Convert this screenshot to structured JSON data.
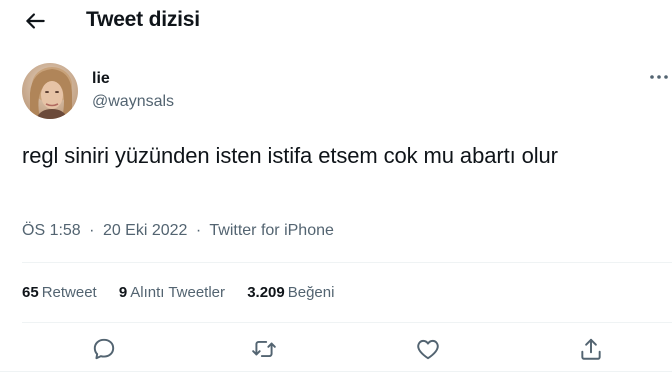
{
  "header": {
    "title": "Tweet dizisi",
    "back_icon": "arrow-left-icon"
  },
  "author": {
    "display_name": "lie",
    "handle": "@waynsals",
    "avatar_icon": "profile-photo"
  },
  "tweet": {
    "text": "regl siniri yüzünden isten istifa etsem cok mu abartı olur",
    "time": "ÖS 1:58",
    "date": "20 Eki 2022",
    "source": "Twitter for iPhone",
    "separator": "·"
  },
  "stats": {
    "retweets": {
      "count": "65",
      "label": "Retweet"
    },
    "quotes": {
      "count": "9",
      "label": "Alıntı Tweetler"
    },
    "likes": {
      "count": "3.209",
      "label": "Beğeni"
    }
  },
  "actions": [
    "reply-icon",
    "retweet-icon",
    "like-icon",
    "share-icon"
  ],
  "colors": {
    "text": "#0f1419",
    "secondary": "#536471",
    "divider": "#eff3f4"
  }
}
